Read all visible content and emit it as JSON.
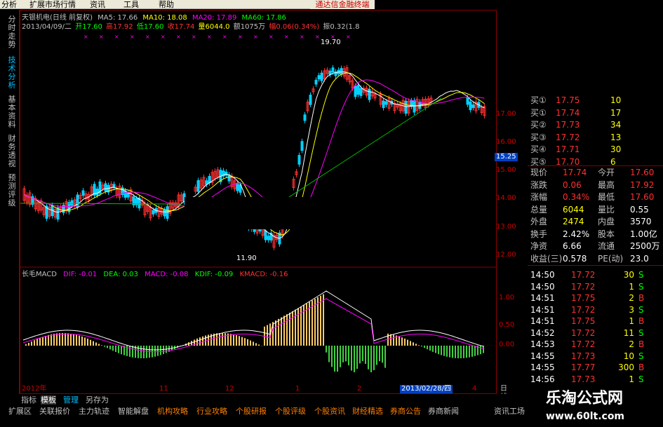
{
  "menu": [
    "分析",
    "扩展市场行情",
    "资讯",
    "工具",
    "帮助"
  ],
  "banner": "通达信金融终端",
  "left_tabs": [
    {
      "label": "分时走势",
      "active": false
    },
    {
      "label": "技术分析",
      "active": true
    },
    {
      "label": "基本资料",
      "active": false
    },
    {
      "label": "财务透视",
      "active": false
    },
    {
      "label": "预测评级",
      "active": false
    }
  ],
  "header": {
    "title": "天银机电(日线 前复权)",
    "ma5": "MA5: 17.66",
    "ma10": "MA10: 18.08",
    "ma20": "MA20: 17.89",
    "ma60": "MA60: 17.86",
    "date": "2013/04/09/二",
    "open": "开17.60",
    "high": "高17.92",
    "low": "低17.60",
    "close": "收17.74",
    "vol": "量6044.0",
    "amount": "额1075万",
    "change": "幅0.06(0.34%)",
    "amp": "振0.32(1.8"
  },
  "price_axis": [
    "17.00",
    "16.00",
    "15.25",
    "15.00",
    "14.00",
    "13.00",
    "12.00"
  ],
  "annotations": {
    "high": "19.70",
    "low": "11.90"
  },
  "macd": {
    "title": "长毛MACD",
    "dif": "DIF: -0.01",
    "dea": "DEA: 0.03",
    "macd": "MACD: -0.08",
    "kdif": "KDIF: -0.09",
    "kmacd": "KMACD: -0.16"
  },
  "macd_axis": [
    "1.00",
    "0.50",
    "0.00"
  ],
  "time_axis": {
    "year": "2012年",
    "m1": "11",
    "m2": "12",
    "m3": "1",
    "m4": "2",
    "m5": "4",
    "cursor": "2013/02/28/四",
    "period": "日线"
  },
  "quote_buy": [
    {
      "label": "买①",
      "price": "17.75",
      "vol": "10"
    },
    {
      "label": "买①",
      "price": "17.74",
      "vol": "17"
    },
    {
      "label": "买②",
      "price": "17.73",
      "vol": "34"
    },
    {
      "label": "买③",
      "price": "17.72",
      "vol": "13"
    },
    {
      "label": "买④",
      "price": "17.71",
      "vol": "30"
    },
    {
      "label": "买⑤",
      "price": "17.70",
      "vol": "6"
    }
  ],
  "quote_info": [
    {
      "l1": "现价",
      "v1": "17.74",
      "l2": "今开",
      "v2": "17.60"
    },
    {
      "l1": "涨跌",
      "v1": "0.06",
      "l2": "最高",
      "v2": "17.92"
    },
    {
      "l1": "涨幅",
      "v1": "0.34%",
      "l2": "最低",
      "v2": "17.60"
    },
    {
      "l1": "总量",
      "v1": "6044",
      "l2": "量比",
      "v2": "0.55"
    },
    {
      "l1": "外盘",
      "v1": "2474",
      "l2": "内盘",
      "v2": "3570"
    },
    {
      "l1": "换手",
      "v1": "2.42%",
      "l2": "股本",
      "v2": "1.00亿"
    },
    {
      "l1": "净资",
      "v1": "6.66",
      "l2": "流通",
      "v2": "2500万"
    },
    {
      "l1": "收益(三)",
      "v1": "0.578",
      "l2": "PE(动)",
      "v2": "23.0"
    }
  ],
  "ticks": [
    {
      "t": "14:50",
      "p": "17.72",
      "v": "30",
      "s": "S"
    },
    {
      "t": "14:50",
      "p": "17.72",
      "v": "1",
      "s": "S"
    },
    {
      "t": "14:51",
      "p": "17.75",
      "v": "2",
      "s": "B"
    },
    {
      "t": "14:51",
      "p": "17.72",
      "v": "3",
      "s": "S"
    },
    {
      "t": "14:51",
      "p": "17.75",
      "v": "1",
      "s": "B"
    },
    {
      "t": "14:52",
      "p": "17.72",
      "v": "11",
      "s": "S"
    },
    {
      "t": "14:53",
      "p": "17.72",
      "v": "2",
      "s": "B"
    },
    {
      "t": "14:55",
      "p": "17.73",
      "v": "10",
      "s": "S"
    },
    {
      "t": "14:55",
      "p": "17.77",
      "v": "300",
      "s": "B"
    },
    {
      "t": "14:56",
      "p": "17.73",
      "v": "1",
      "s": "S"
    }
  ],
  "bottom_tabs": [
    "指标",
    "模板",
    "管理",
    "另存为"
  ],
  "toolbar": [
    "扩展区",
    "关联报价",
    "主力轨迹",
    "智能解盘",
    "机构攻略",
    "行业攻略",
    "个股研报",
    "个股评级",
    "个股资讯",
    "财经精选",
    "券商公告",
    "券商新闻",
    "资讯工场"
  ],
  "watermark": {
    "line1": "乐淘公式网",
    "line2": "www.60lt.com"
  }
}
